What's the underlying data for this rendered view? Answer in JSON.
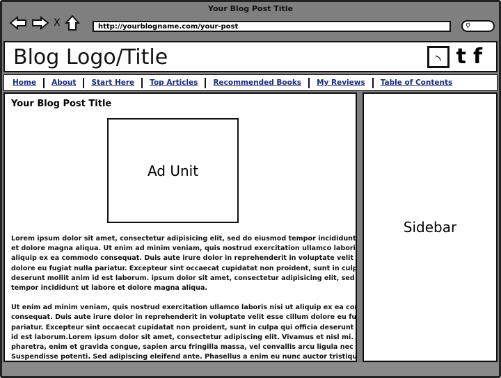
{
  "window": {
    "title": "Your Blog Post Title",
    "url": "http://yourblogname.com/your-post",
    "icons": [
      "back-arrow-icon",
      "forward-arrow-icon",
      "stop-icon",
      "home-icon",
      "search-icon"
    ],
    "stop_glyph": "X"
  },
  "header": {
    "logo": "Blog Logo/Title",
    "social": [
      "rss-icon",
      "twitter-icon",
      "facebook-icon"
    ]
  },
  "nav": [
    "Home",
    "About",
    "Start Here",
    "Top Articles",
    "Recommended Books",
    "My Reviews",
    "Table of Contents"
  ],
  "post": {
    "title": "Your Blog Post Title",
    "ad_label": "Ad Unit",
    "paragraphs": [
      [
        "Lorem ipsum dolor sit amet, consectetur adipisicing elit, sed do eiusmod tempor incididunt ut labore",
        "et dolore magna aliqua. Ut enim ad minim veniam, quis nostrud exercitation ullamco laboris nisi ut",
        "aliquip ex ea commodo consequat. Duis aute irure dolor in reprehenderit in voluptate velit esse cillum",
        "dolore eu fugiat nulla pariatur. Excepteur sint occaecat cupidatat non proident, sunt in culpa qui officia",
        "deserunt mollit anim id est laborum. ipsum dolor sit amet, consectetur adipisicing elit, sed do eiusmod",
        "tempor incididunt ut labore et dolore magna aliqua."
      ],
      [
        "Ut enim ad minim veniam, quis nostrud exercitation ullamco laboris nisi ut aliquip ex ea commodo",
        "consequat. Duis aute irure dolor in reprehenderit in voluptate velit esse cillum dolore eu fugiat nulla",
        "pariatur. Excepteur sint occaecat cupidatat non proident, sunt in culpa qui officia deserunt mollit anim",
        "id est laborum.Lorem ipsum dolor sit amet, consectetur adipiscing elit. Vivamus et nisl mi. Fusce",
        "pharetra, enim et gravida congue, sapien arcu fringilla massa, vel convallis arcu ligula nec quam.",
        "Suspendisse potenti. Sed adipiscing eleifend ante. Phasellus a enim eu nunc auctor tristique quis non"
      ]
    ]
  },
  "sidebar": {
    "label": "Sidebar"
  }
}
